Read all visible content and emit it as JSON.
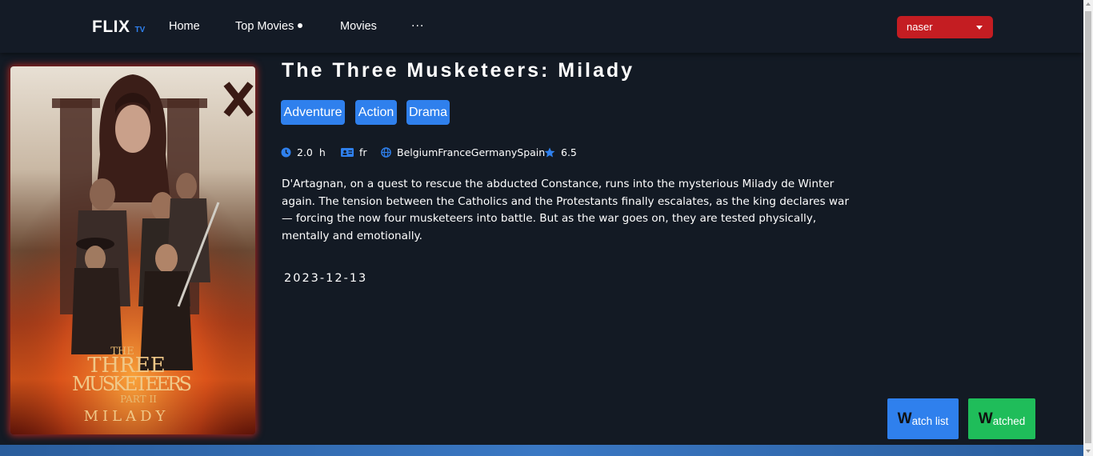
{
  "nav": {
    "logo_main": "FLIX",
    "logo_sub": "TV",
    "links": [
      "Home",
      "Top Movies",
      "Movies"
    ],
    "more_label": "···",
    "user": "naser"
  },
  "movie": {
    "title": "The Three Musketeers: Milady",
    "genres": [
      "Adventure",
      "Action",
      "Drama"
    ],
    "runtime": "2.0  h",
    "language": "fr",
    "countries": "BelgiumFranceGermanySpain",
    "rating": "6.5",
    "overview": "D'Artagnan, on a quest to rescue the abducted Constance, runs into the mysterious Milady de Winter again. The tension between the Catholics and the Protestants finally escalates, as the king declares war — forcing the now four musketeers into battle. But as the war goes on, they are tested physically, mentally and emotionally.",
    "release_date": "2023-12-13",
    "poster": {
      "line1": "THE",
      "line2": "THREE",
      "line3": "MUSKETEERS",
      "line4": "PART II",
      "line5": "MILADY"
    }
  },
  "actions": {
    "watchlist_initial": "W",
    "watchlist_rest": "atch list",
    "watched_initial": "W",
    "watched_rest": "atched"
  },
  "colors": {
    "background": "#131a24",
    "accent_blue": "#2f80ed",
    "user_red": "#c41d22",
    "watched_green": "#1fbd5a"
  },
  "icons": [
    "clock-icon",
    "id-card-icon",
    "globe-icon",
    "star-icon"
  ]
}
